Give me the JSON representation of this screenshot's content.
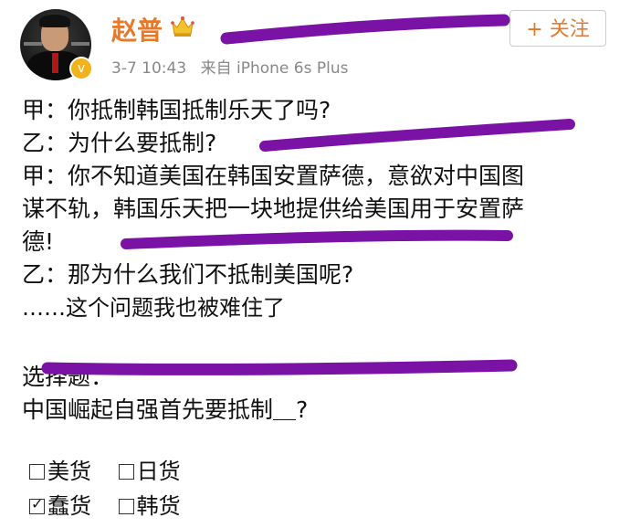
{
  "post": {
    "author": "赵普",
    "timestamp": "3-7 10:43",
    "source": "来自 iPhone 6s Plus",
    "follow_label": "+ 关注",
    "lines": [
      "甲：你抵制韩国抵制乐天了吗?",
      "乙：为什么要抵制?",
      "甲：你不知道美国在韩国安置萨德，意欲对中国图",
      "谋不轨，韩国乐天把一块地提供给美国用于安置萨",
      "德!",
      "乙：那为什么我们不抵制美国呢?",
      "……这个问题我也被难住了"
    ],
    "quiz_title": "选择题：",
    "quiz_question": "中国崛起自强首先要抵制＿?",
    "options": [
      {
        "label": "美货",
        "checked": false
      },
      {
        "label": "日货",
        "checked": false
      },
      {
        "label": "蠢货",
        "checked": true
      },
      {
        "label": "韩货",
        "checked": false
      }
    ]
  },
  "icons": {
    "verified": "verified-badge-icon",
    "crown": "crown-icon",
    "checkbox": "checkbox-icon"
  },
  "colors": {
    "username": "#e8792a",
    "annotation_stroke": "#7a12a6",
    "meta": "#888888"
  }
}
